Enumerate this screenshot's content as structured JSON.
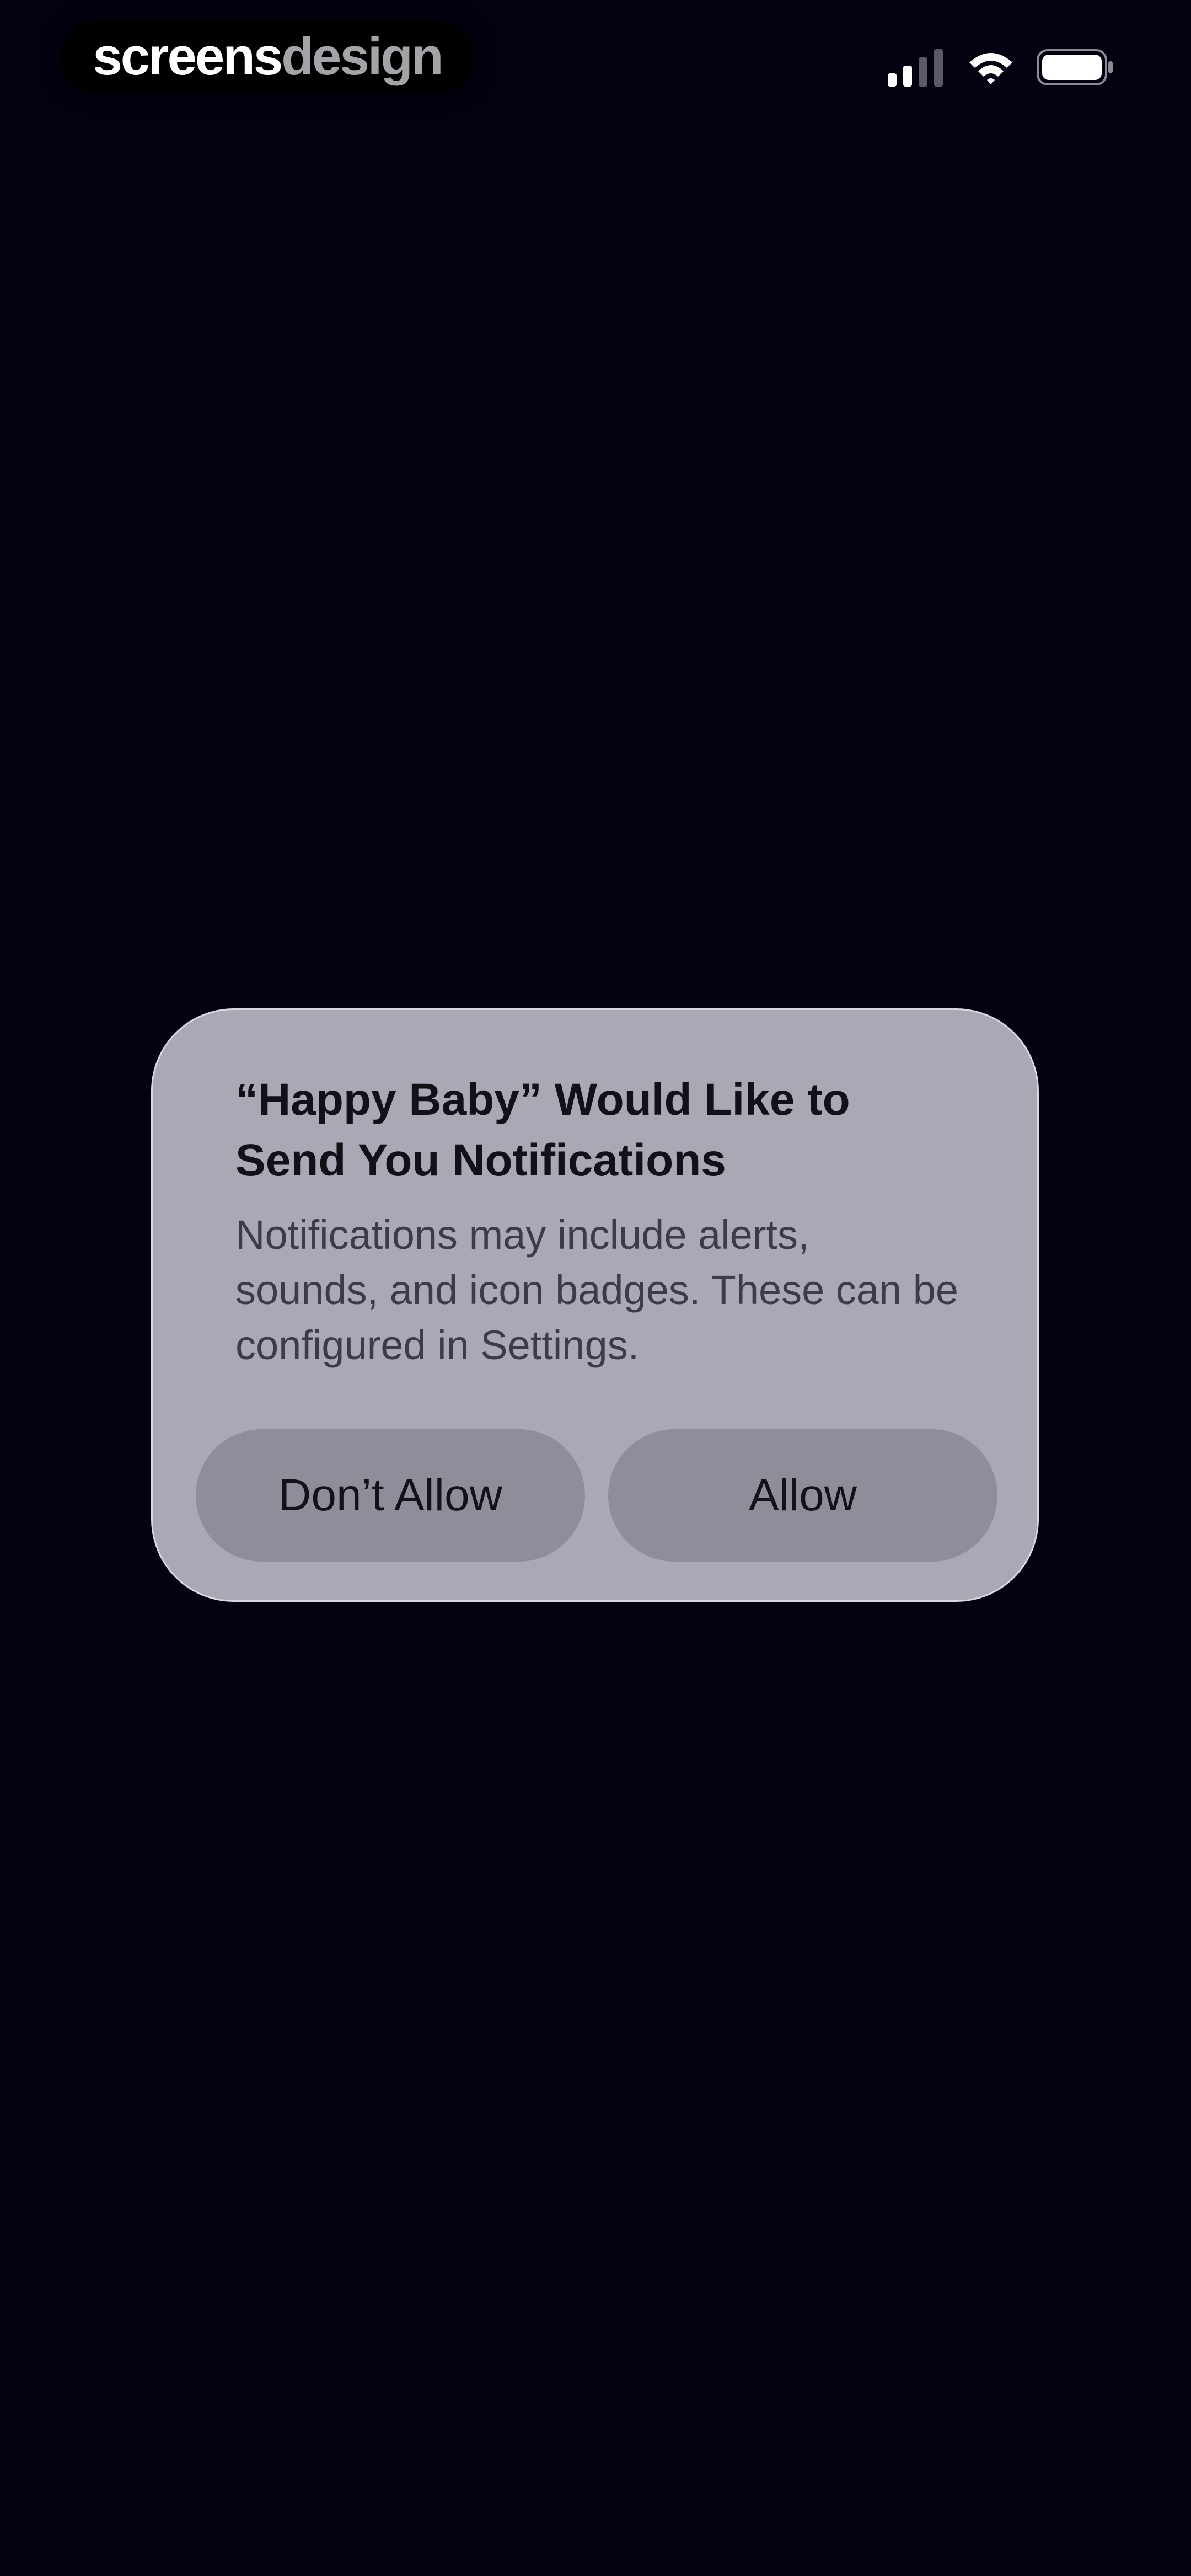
{
  "status_bar": {
    "brand_part1": "screens",
    "brand_part2": "design",
    "signal_icon": "cellular-signal-icon",
    "wifi_icon": "wifi-icon",
    "battery_icon": "battery-icon"
  },
  "alert": {
    "title": "“Happy Baby” Would Like to Send You Notifications",
    "message": "Notifications may include alerts, sounds, and icon badges. These can be configured in Settings.",
    "deny_label": "Don’t Allow",
    "allow_label": "Allow"
  },
  "colors": {
    "background": "#020211",
    "alert_background": "#a9a8b4",
    "button_background": "#8e8d99"
  }
}
